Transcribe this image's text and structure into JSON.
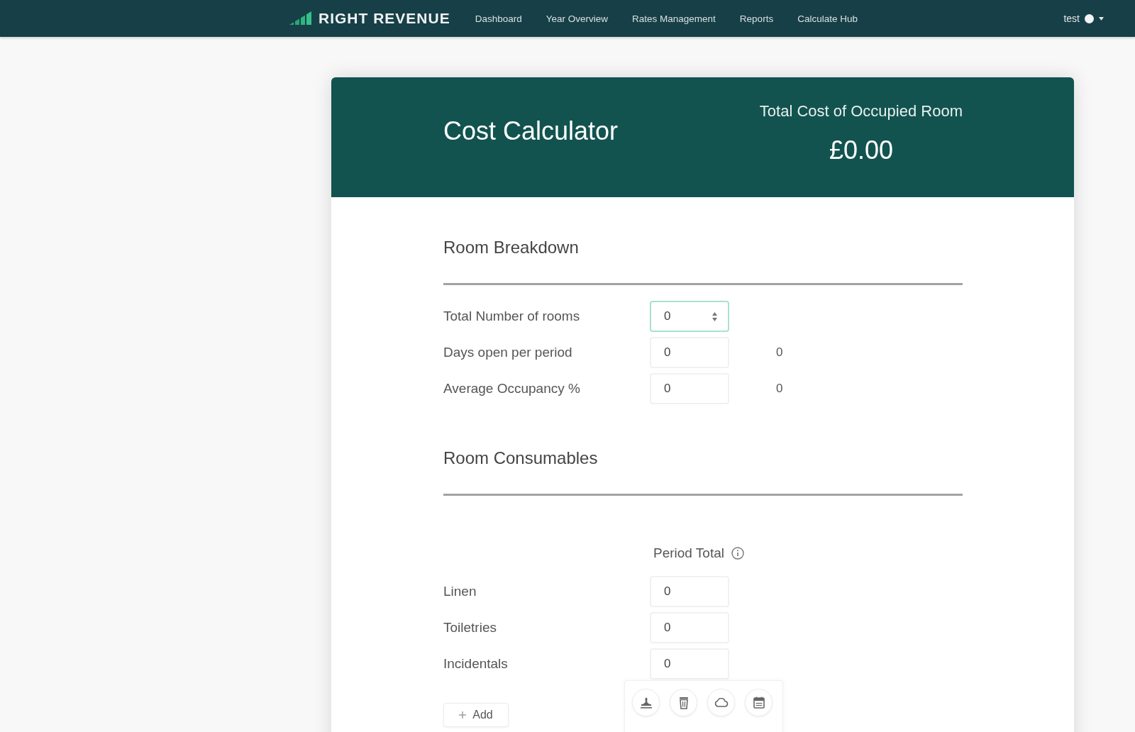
{
  "navbar": {
    "brand": "RIGHT REVENUE",
    "links": [
      {
        "label": "Dashboard",
        "selected": false
      },
      {
        "label": "Year Overview",
        "selected": false
      },
      {
        "label": "Rates Management",
        "selected": false
      },
      {
        "label": "Reports",
        "selected": false
      },
      {
        "label": "Calculate Hub",
        "selected": false
      }
    ],
    "user": {
      "name": "test"
    }
  },
  "calculator": {
    "title": "Cost Calculator",
    "total": {
      "label": "Total Cost of Occupied Room",
      "value": "£0.00"
    }
  },
  "room_breakdown": {
    "title": "Room Breakdown",
    "rows": [
      {
        "label": "Total Number of rooms",
        "value": "0",
        "focused": true
      },
      {
        "label": "Days open per period",
        "value": "0",
        "focused": false,
        "result": "0"
      },
      {
        "label": "Average Occupancy %",
        "value": "0",
        "focused": false,
        "result": "0"
      }
    ]
  },
  "room_consumables": {
    "title": "Room Consumables",
    "column_header": "Period Total",
    "rows": [
      {
        "label": "Linen",
        "value": "0",
        "focused": false
      },
      {
        "label": "Toiletries",
        "value": "0",
        "focused": false
      },
      {
        "label": "Incidentals",
        "value": "0",
        "focused": false
      }
    ],
    "add_button": "Add"
  }
}
